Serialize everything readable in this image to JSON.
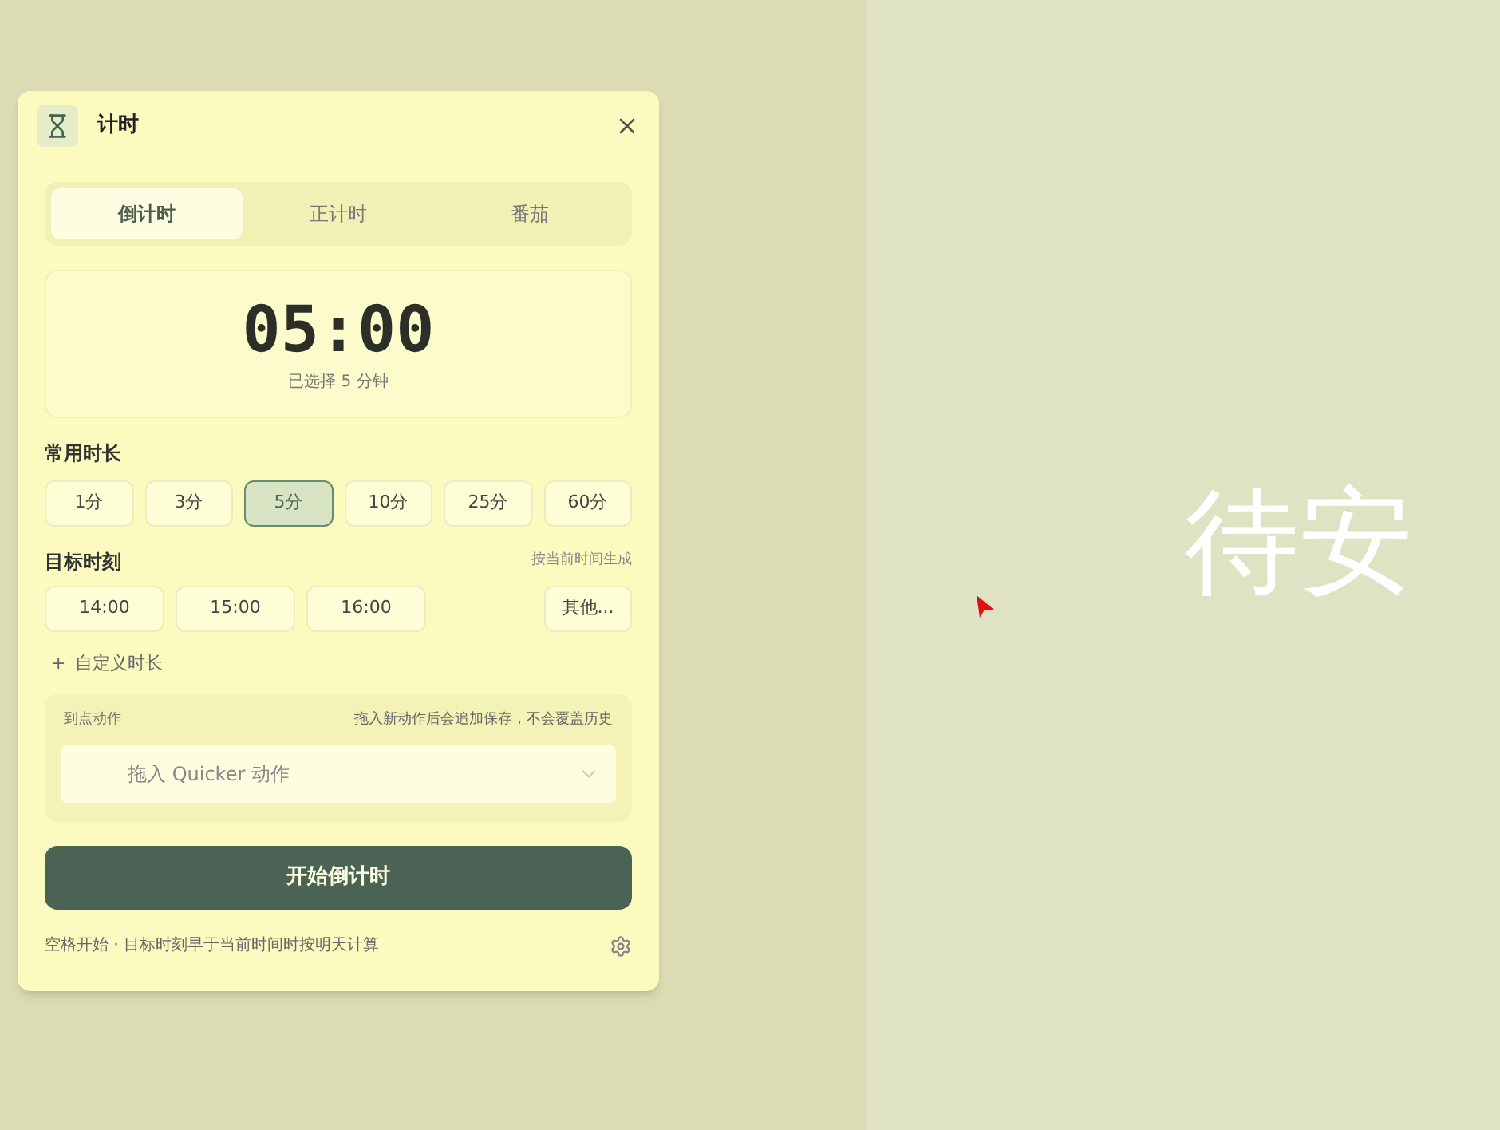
{
  "window": {
    "title": "计时"
  },
  "tabs": [
    {
      "label": "倒计时",
      "selected": true
    },
    {
      "label": "正计时",
      "selected": false
    },
    {
      "label": "番茄",
      "selected": false
    }
  ],
  "display": {
    "time": "05:00",
    "caption": "已选择 5 分钟"
  },
  "durations": {
    "title": "常用时长",
    "options": [
      {
        "label": "1分",
        "selected": false
      },
      {
        "label": "3分",
        "selected": false
      },
      {
        "label": "5分",
        "selected": true
      },
      {
        "label": "10分",
        "selected": false
      },
      {
        "label": "25分",
        "selected": false
      },
      {
        "label": "60分",
        "selected": false
      }
    ]
  },
  "target": {
    "title": "目标时刻",
    "hint": "按当前时间生成",
    "times": [
      "14:00",
      "15:00",
      "16:00"
    ],
    "other": "其他..."
  },
  "custom_duration": {
    "icon": "+",
    "label": "自定义时长"
  },
  "finish_action": {
    "label": "到点动作",
    "hint": "拖入新动作后会追加保存，不会覆盖历史",
    "placeholder": "拖入 Quicker 动作"
  },
  "start_button": "开始倒计时",
  "footer": "空格开始 · 目标时刻早于当前时间时按明天计算",
  "background": {
    "text": "待安"
  }
}
